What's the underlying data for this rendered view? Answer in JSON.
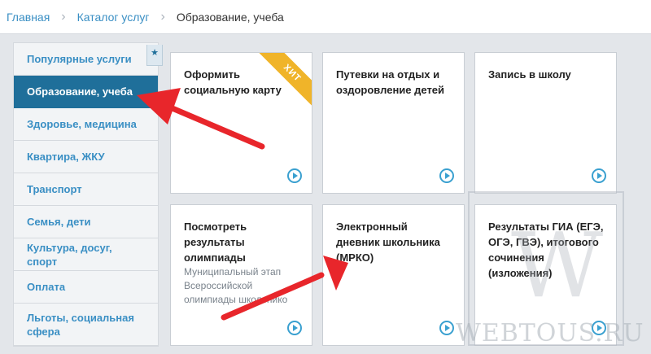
{
  "breadcrumb": {
    "home": "Главная",
    "catalog": "Каталог услуг",
    "current": "Образование, учеба"
  },
  "sidebar": {
    "bookmark_icon": "star-icon",
    "items": [
      {
        "label": "Популярные услуги"
      },
      {
        "label": "Образование, учеба"
      },
      {
        "label": "Здоровье, медицина"
      },
      {
        "label": "Квартира, ЖКУ"
      },
      {
        "label": "Транспорт"
      },
      {
        "label": "Семья, дети"
      },
      {
        "label": "Культура, досуг, спорт"
      },
      {
        "label": "Оплата"
      },
      {
        "label": "Льготы, социальная сфера"
      }
    ]
  },
  "cards": [
    {
      "title": "Оформить социальную карту",
      "badge": "ХИТ"
    },
    {
      "title": "Путевки на отдых и оздоровление детей"
    },
    {
      "title": "Запись в школу"
    },
    {
      "title": "Посмотреть результаты олимпиады",
      "description": "Муниципальный этап Всероссийской олимпиады школьнико"
    },
    {
      "title": "Электронный дневник школьника (МРКО)"
    },
    {
      "title": "Результаты ГИА (ЕГЭ, ОГЭ, ГВЭ), итогового сочинения (изложения)"
    }
  ],
  "watermark": {
    "letter": "W",
    "text": "WEBTOUS.RU"
  },
  "colors": {
    "accent": "#1f6f9a",
    "link": "#3a8fc4",
    "badge": "#f0b429",
    "arrow": "#e8262b"
  }
}
